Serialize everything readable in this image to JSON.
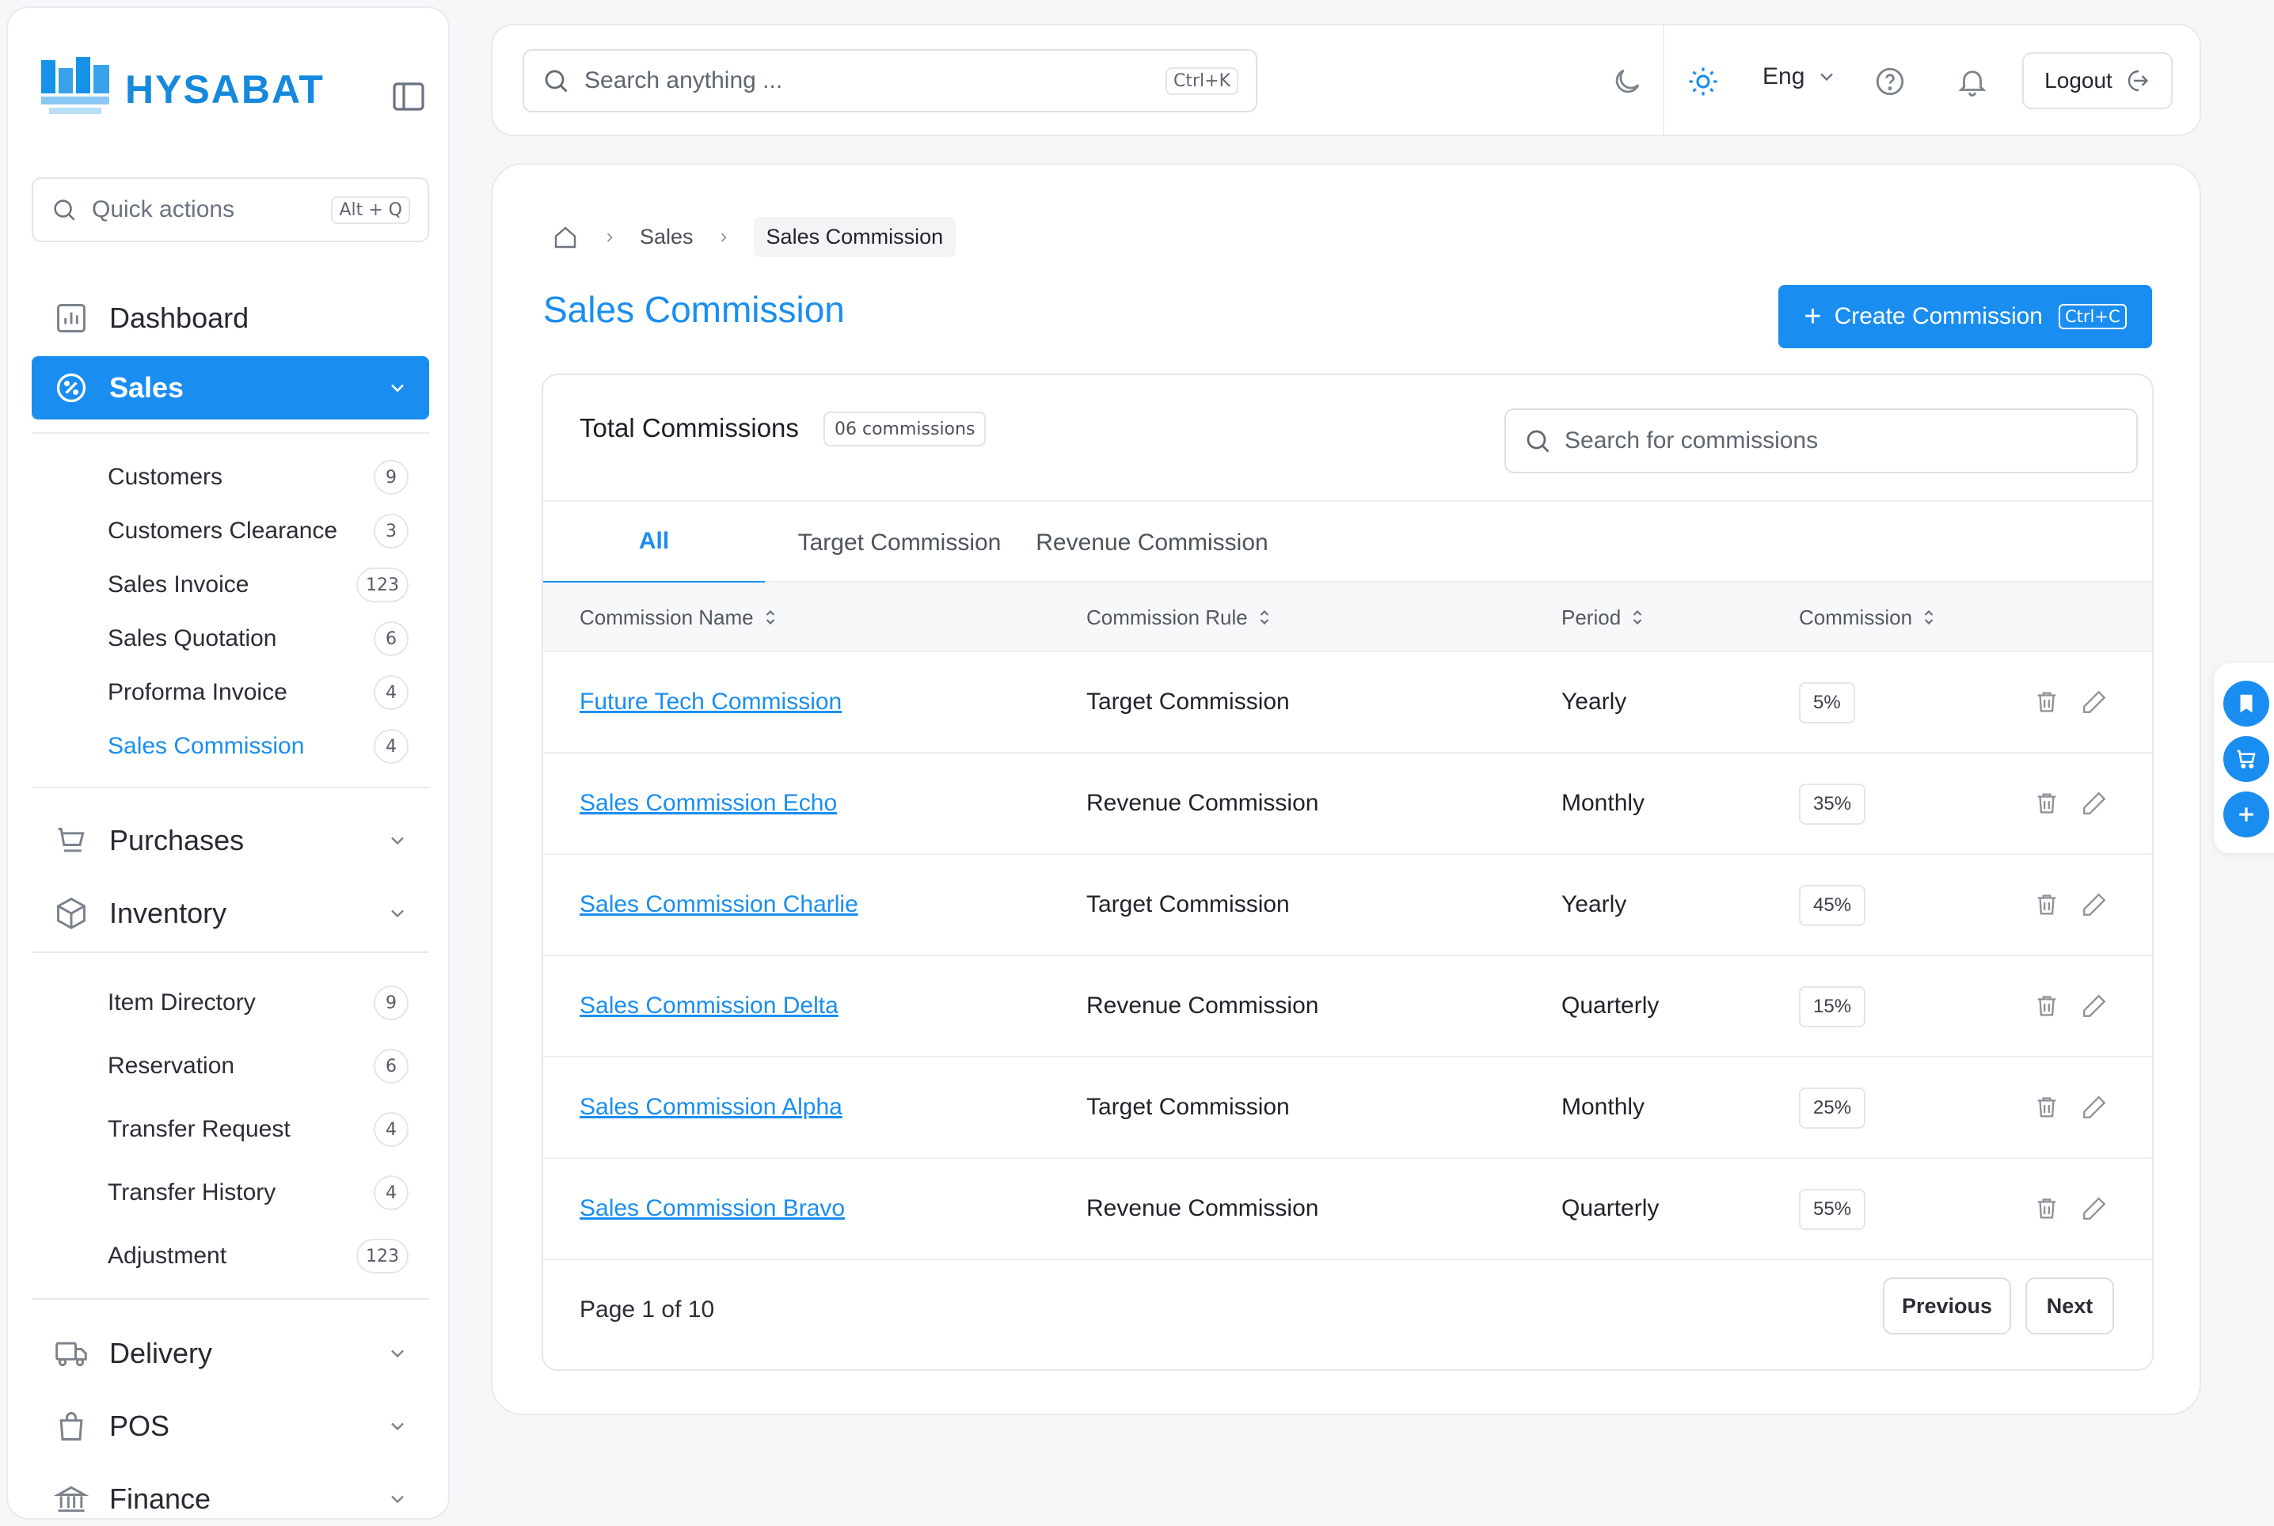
{
  "brand": {
    "name": "HYSABAT",
    "color": "#1a8ef0"
  },
  "sidebar": {
    "quick_actions": {
      "placeholder": "Quick actions",
      "shortcut": "Alt + Q"
    },
    "dashboard": "Dashboard",
    "sales": {
      "label": "Sales",
      "items": [
        {
          "label": "Customers",
          "count": "9"
        },
        {
          "label": "Customers Clearance",
          "count": "3"
        },
        {
          "label": "Sales Invoice",
          "count": "123"
        },
        {
          "label": "Sales Quotation",
          "count": "6"
        },
        {
          "label": "Proforma Invoice",
          "count": "4"
        },
        {
          "label": "Sales Commission",
          "count": "4"
        }
      ]
    },
    "purchases": "Purchases",
    "inventory": {
      "label": "Inventory",
      "items": [
        {
          "label": "Item Directory",
          "count": "9"
        },
        {
          "label": "Reservation",
          "count": "6"
        },
        {
          "label": "Transfer Request",
          "count": "4"
        },
        {
          "label": "Transfer History",
          "count": "4"
        },
        {
          "label": "Adjustment",
          "count": "123"
        }
      ]
    },
    "delivery": "Delivery",
    "pos": "POS",
    "finance": "Finance"
  },
  "topbar": {
    "search": {
      "placeholder": "Search anything ...",
      "shortcut": "Ctrl+K"
    },
    "language": "Eng",
    "logout": "Logout"
  },
  "breadcrumb": {
    "parent": "Sales",
    "current": "Sales Commission"
  },
  "page": {
    "title": "Sales Commission",
    "create_button": "Create Commission",
    "create_shortcut": "Ctrl+C"
  },
  "table": {
    "title": "Total Commissions",
    "count_label": "06 commissions",
    "search_placeholder": "Search for commissions",
    "tabs": [
      "All",
      "Target Commission",
      "Revenue Commission"
    ],
    "columns": [
      "Commission Name",
      "Commission Rule",
      "Period",
      "Commission"
    ],
    "rows": [
      {
        "name": "Future Tech Commission",
        "rule": "Target Commission",
        "period": "Yearly",
        "commission": "5%"
      },
      {
        "name": "Sales Commission Echo",
        "rule": "Revenue Commission",
        "period": "Monthly",
        "commission": "35%"
      },
      {
        "name": "Sales Commission Charlie",
        "rule": "Target Commission",
        "period": "Yearly",
        "commission": "45%"
      },
      {
        "name": "Sales Commission Delta",
        "rule": "Revenue Commission",
        "period": "Quarterly",
        "commission": "15%"
      },
      {
        "name": "Sales Commission Alpha",
        "rule": "Target Commission",
        "period": "Monthly",
        "commission": "25%"
      },
      {
        "name": "Sales Commission Bravo",
        "rule": "Revenue Commission",
        "period": "Quarterly",
        "commission": "55%"
      }
    ],
    "pagination": {
      "info": "Page 1 of 10",
      "previous": "Previous",
      "next": "Next"
    }
  }
}
